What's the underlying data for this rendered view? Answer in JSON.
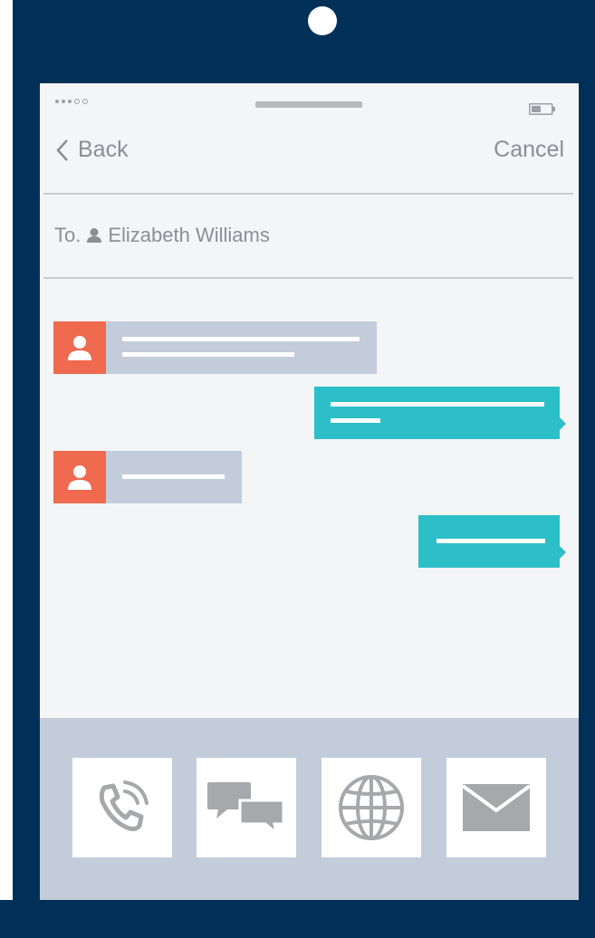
{
  "nav": {
    "back_label": "Back",
    "cancel_label": "Cancel"
  },
  "recipient": {
    "prefix": "To.",
    "name": "Elizabeth Williams"
  },
  "messages": [
    {
      "direction": "incoming",
      "lines": 2
    },
    {
      "direction": "outgoing",
      "lines": 2
    },
    {
      "direction": "incoming",
      "lines": 1
    },
    {
      "direction": "outgoing",
      "lines": 1
    }
  ],
  "dock": {
    "buttons": [
      {
        "icon": "phone-icon"
      },
      {
        "icon": "chat-icon"
      },
      {
        "icon": "globe-icon"
      },
      {
        "icon": "mail-icon"
      }
    ]
  },
  "colors": {
    "frame": "#003057",
    "screen": "#f4f5f7",
    "avatar": "#ef6a4f",
    "incoming_bubble": "#c3ccda",
    "outgoing_bubble": "#2dbfc8",
    "icon_gray": "#a6a8ab"
  }
}
